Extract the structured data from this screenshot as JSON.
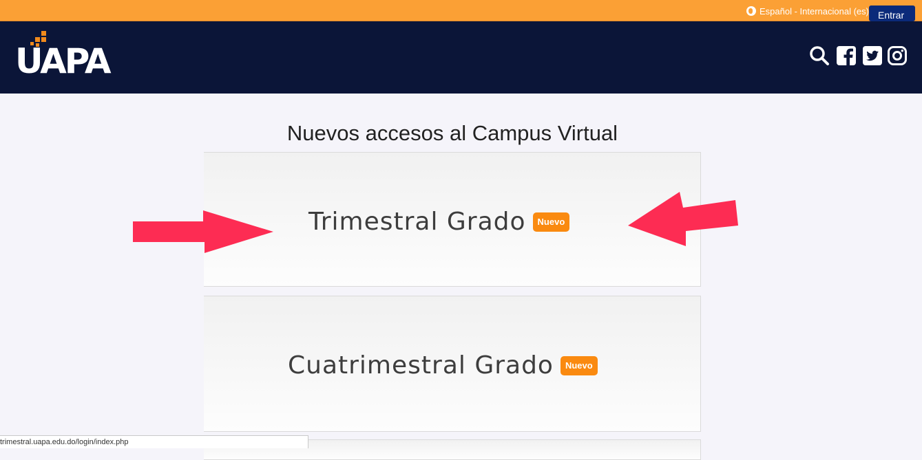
{
  "topbar": {
    "language": "Español - Internacional (es)",
    "login_label": "Entrar",
    "bg_color": "#fba035"
  },
  "header": {
    "logo_text": "UAPA",
    "bg_color": "#0b1538",
    "icons": [
      "search-icon",
      "facebook-icon",
      "twitter-icon",
      "instagram-icon"
    ]
  },
  "main": {
    "title": "Nuevos accesos al Campus Virtual",
    "cards": [
      {
        "label": "Trimestral Grado",
        "badge": "Nuevo"
      },
      {
        "label": "Cuatrimestral Grado",
        "badge": "Nuevo"
      }
    ]
  },
  "status_bar": {
    "url": "trimestral.uapa.edu.do/login/index.php"
  },
  "colors": {
    "accent": "#fa8a10",
    "arrow": "#fd2c53"
  }
}
